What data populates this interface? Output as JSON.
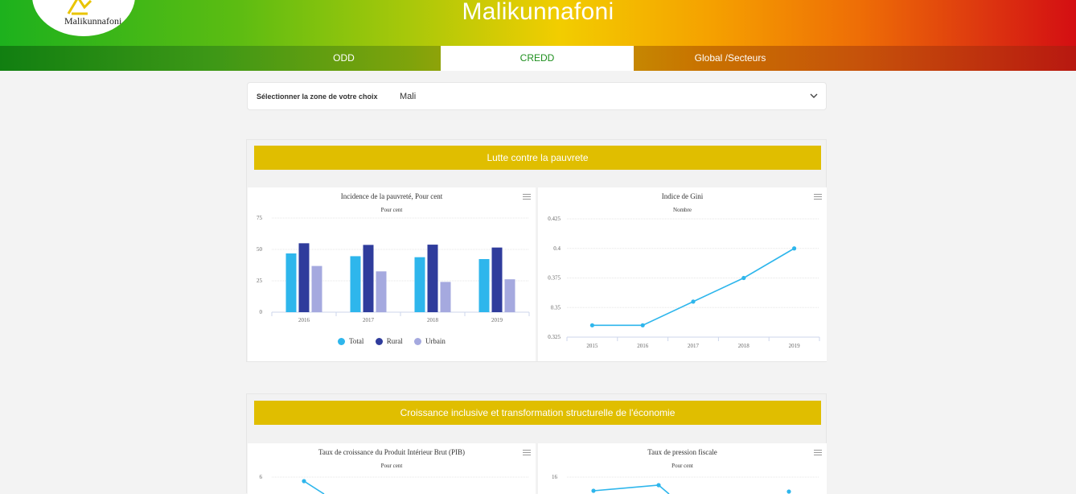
{
  "app": {
    "title": "Malikunnafoni",
    "logo_text": "Malikunnafoni"
  },
  "nav": {
    "tabs": [
      {
        "label": "ODD",
        "active": false
      },
      {
        "label": "CREDD",
        "active": true
      },
      {
        "label": "Global /Secteurs",
        "active": false
      }
    ]
  },
  "selector": {
    "label": "Sélectionner la zone de votre choix",
    "value": "Mali"
  },
  "sections": [
    {
      "title": "Lutte contre la pauvrete"
    },
    {
      "title": "Croissance inclusive et transformation structurelle de l'économie"
    }
  ],
  "chart_data": [
    {
      "type": "bar",
      "title": "Incidence de la pauvreté, Pour cent",
      "subtitle": "Pour cent",
      "categories": [
        "2016",
        "2017",
        "2018",
        "2019"
      ],
      "series": [
        {
          "name": "Total",
          "color": "#2eb6ec",
          "values": [
            46.8,
            44.6,
            43.8,
            42.3
          ]
        },
        {
          "name": "Rural",
          "color": "#2f3c9c",
          "values": [
            54.9,
            53.6,
            53.8,
            51.5
          ]
        },
        {
          "name": "Urbain",
          "color": "#a5a9df",
          "values": [
            36.8,
            32.5,
            24.1,
            26.2
          ]
        }
      ],
      "ylim": [
        0,
        75
      ],
      "yticks": [
        "0",
        "25",
        "50",
        "75"
      ],
      "grid": true,
      "legend": "bottom"
    },
    {
      "type": "line",
      "title": "Indice de Gini",
      "subtitle": "Nombre",
      "x": [
        "2015",
        "2016",
        "2017",
        "2018",
        "2019"
      ],
      "series": [
        {
          "color": "#2eb6ec",
          "values": [
            0.335,
            0.335,
            0.355,
            0.375,
            0.4
          ]
        }
      ],
      "ylim": [
        0.325,
        0.425
      ],
      "yticks": [
        "0.325",
        "0.35",
        "0.375",
        "0.4",
        "0.425"
      ],
      "grid": true
    },
    {
      "type": "line",
      "title": "Taux de croissance du Produit Intérieur Brut (PIB)",
      "subtitle": "Pour cent",
      "yticks": [
        "6"
      ],
      "partial": true
    },
    {
      "type": "line",
      "title": "Taux de pression fiscale",
      "subtitle": "Pour cent",
      "yticks": [
        "16"
      ],
      "partial": true
    }
  ]
}
